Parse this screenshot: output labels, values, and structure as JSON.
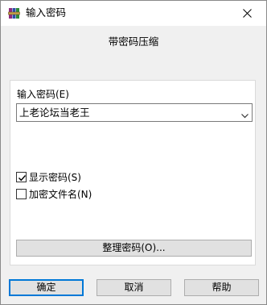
{
  "window": {
    "title": "输入密码",
    "app_icon": "winrar-books-icon",
    "close_icon": "close-icon"
  },
  "heading": "带密码压缩",
  "password": {
    "label": "输入密码(E)",
    "value": "上老论坛当老王",
    "dropdown_icon": "chevron-down-icon"
  },
  "options": {
    "show_password": {
      "label": "显示密码(S)",
      "checked": true
    },
    "encrypt_filenames": {
      "label": "加密文件名(N)",
      "checked": false
    }
  },
  "buttons": {
    "organize": "整理密码(O)...",
    "ok": "确定",
    "cancel": "取消",
    "help": "帮助"
  },
  "colors": {
    "dialog_bg": "#f0f0f0",
    "button_bg": "#e1e1e1",
    "accent": "#0078d7"
  }
}
